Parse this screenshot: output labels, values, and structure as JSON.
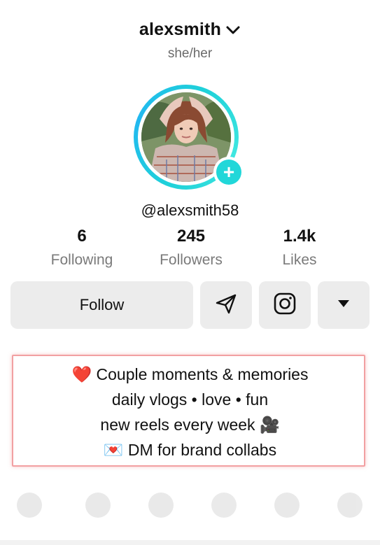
{
  "header": {
    "username": "alexsmith",
    "dropdown_icon": "chevron-down-icon"
  },
  "profile": {
    "pronouns": "she/her",
    "handle": "@alexsmith58",
    "avatar_ring_color": "#1fd1d9",
    "add_badge_icon": "plus-icon",
    "add_badge_color": "#21d7d9"
  },
  "stats": [
    {
      "value": "6",
      "label": "Following"
    },
    {
      "value": "245",
      "label": "Followers"
    },
    {
      "value": "1.4k",
      "label": "Likes"
    }
  ],
  "actions": {
    "follow_label": "Follow",
    "message_icon": "send-icon",
    "instagram_icon": "instagram-icon",
    "more_icon": "triangle-down-icon"
  },
  "bio": {
    "lines": [
      "❤️ Couple moments & memories",
      "daily vlogs • love • fun",
      "new reels every week 🎥",
      "💌 DM for brand collabs"
    ],
    "highlight_color": "#f2a0a2"
  }
}
